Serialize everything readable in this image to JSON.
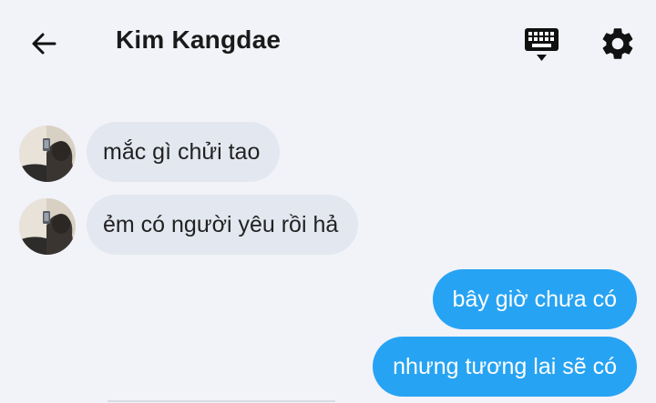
{
  "header": {
    "title": "Kim Kangdae",
    "back_icon": "arrow-left-icon",
    "keyboard_icon": "keyboard-icon",
    "settings_icon": "gear-icon"
  },
  "messages": [
    {
      "direction": "incoming",
      "text": "mắc gì chửi tao"
    },
    {
      "direction": "incoming",
      "text": "ẻm có người yêu rồi hả"
    },
    {
      "direction": "outgoing",
      "text": "bây giờ chưa có"
    },
    {
      "direction": "outgoing",
      "text": "nhưng tương lai sẽ có"
    }
  ],
  "colors": {
    "background": "#f1f3f9",
    "incoming_bubble": "#e3e7ef",
    "outgoing_bubble": "#27a3f3",
    "outgoing_text": "#ffffff"
  }
}
